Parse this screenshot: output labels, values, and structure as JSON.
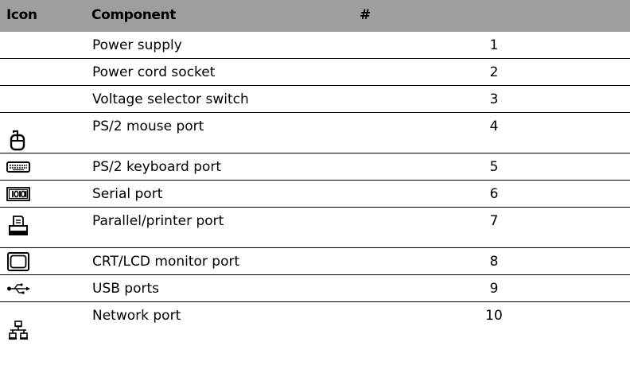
{
  "header": {
    "icon": "Icon",
    "component": "Component",
    "number": "#"
  },
  "rows": [
    {
      "component": "Power supply",
      "number": "1",
      "icon": ""
    },
    {
      "component": "Power cord socket",
      "number": "2",
      "icon": ""
    },
    {
      "component": "Voltage selector switch",
      "number": "3",
      "icon": ""
    },
    {
      "component": "PS/2 mouse port",
      "number": "4",
      "icon": "mouse-icon"
    },
    {
      "component": "PS/2 keyboard port",
      "number": "5",
      "icon": "keyboard-icon"
    },
    {
      "component": "Serial port",
      "number": "6",
      "icon": "serial-port-icon"
    },
    {
      "component": "Parallel/printer port",
      "number": "7",
      "icon": "printer-icon"
    },
    {
      "component": "CRT/LCD monitor port",
      "number": "8",
      "icon": "monitor-icon"
    },
    {
      "component": "USB ports",
      "number": "9",
      "icon": "usb-icon"
    },
    {
      "component": "Network port",
      "number": "10",
      "icon": "network-icon"
    }
  ],
  "colors": {
    "header_bg": "#9e9e9e",
    "rule": "#000000"
  }
}
